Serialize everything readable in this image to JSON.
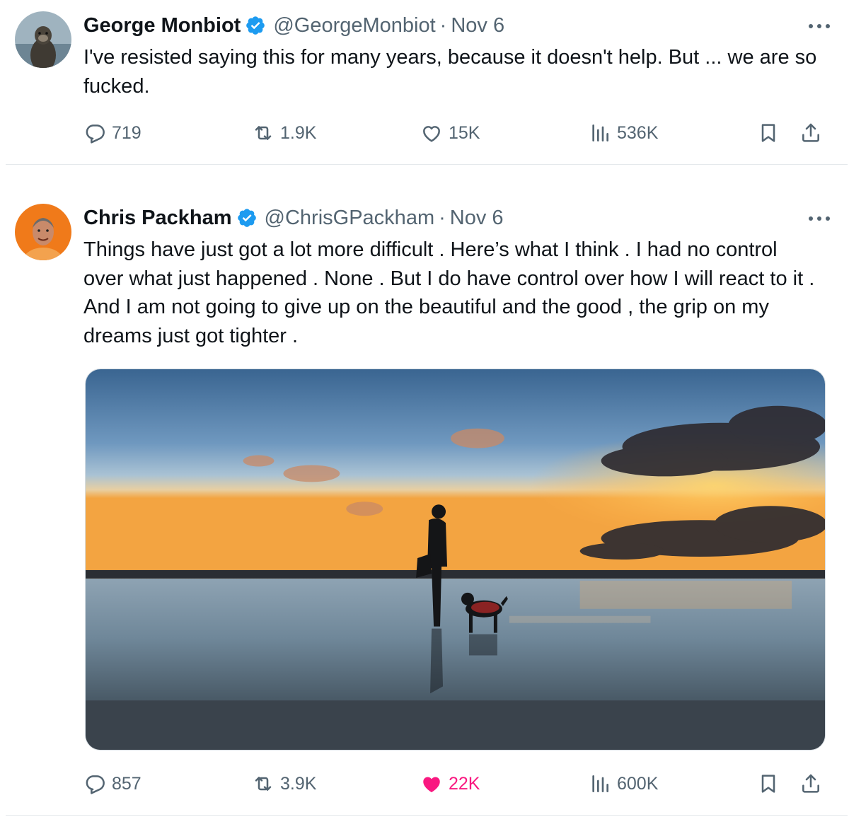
{
  "tweets": [
    {
      "author": {
        "display_name": "George Monbiot",
        "handle": "@GeorgeMonbiot",
        "verified": true,
        "avatar_icon": "otter-photo-avatar"
      },
      "separator": "·",
      "date": "Nov 6",
      "text": "I've resisted saying this for many years, because it doesn't help. But ... we are so fucked.",
      "actions": {
        "replies": "719",
        "reposts": "1.9K",
        "likes": "15K",
        "views": "536K",
        "liked": false
      }
    },
    {
      "author": {
        "display_name": "Chris Packham",
        "handle": "@ChrisGPackham",
        "verified": true,
        "avatar_icon": "portrait-orange-avatar"
      },
      "separator": "·",
      "date": "Nov 6",
      "text": "Things have just got a lot more difficult . Here’s what I think . I had no control over what just happened . None . But I do have control over how I will react to it . And I am not going to give up on the beautiful and the good , the grip on my dreams just got tighter .",
      "media": {
        "icon": "beach-sunset-photo"
      },
      "actions": {
        "replies": "857",
        "reposts": "3.9K",
        "likes": "22K",
        "views": "600K",
        "liked": true
      }
    }
  ],
  "colors": {
    "text": "#0f1419",
    "secondary": "#536471",
    "verified": "#1d9bf0",
    "like_active": "#f91880",
    "divider": "#e5e9ec"
  }
}
